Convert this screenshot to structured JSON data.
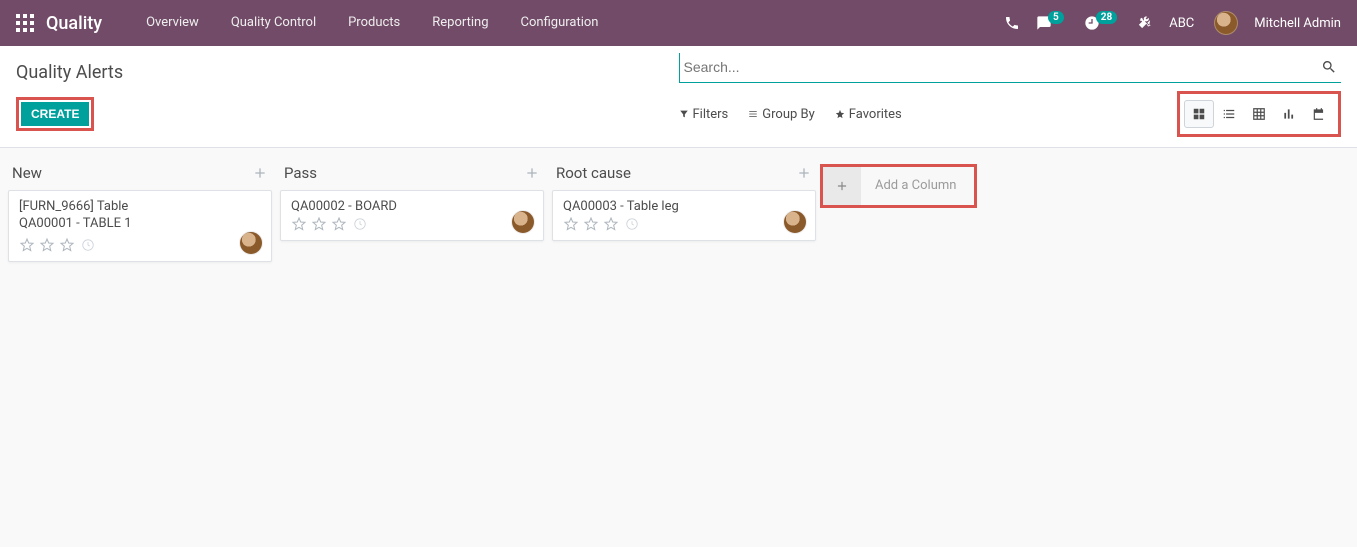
{
  "nav": {
    "brand": "Quality",
    "menu": [
      "Overview",
      "Quality Control",
      "Products",
      "Reporting",
      "Configuration"
    ],
    "messages_badge": "5",
    "activities_badge": "28",
    "company": "ABC",
    "user": "Mitchell Admin"
  },
  "cp": {
    "breadcrumb": "Quality Alerts",
    "create": "CREATE",
    "search_placeholder": "Search...",
    "filters": "Filters",
    "groupby": "Group By",
    "favorites": "Favorites"
  },
  "kanban": {
    "add_column": "Add a Column",
    "columns": [
      {
        "title": "New",
        "cards": [
          {
            "line1": "[FURN_9666] Table",
            "line2": "QA00001 - TABLE 1"
          }
        ]
      },
      {
        "title": "Pass",
        "cards": [
          {
            "line1": "QA00002 - BOARD",
            "line2": ""
          }
        ]
      },
      {
        "title": "Root cause",
        "cards": [
          {
            "line1": "QA00003 - Table leg",
            "line2": ""
          }
        ]
      }
    ]
  }
}
